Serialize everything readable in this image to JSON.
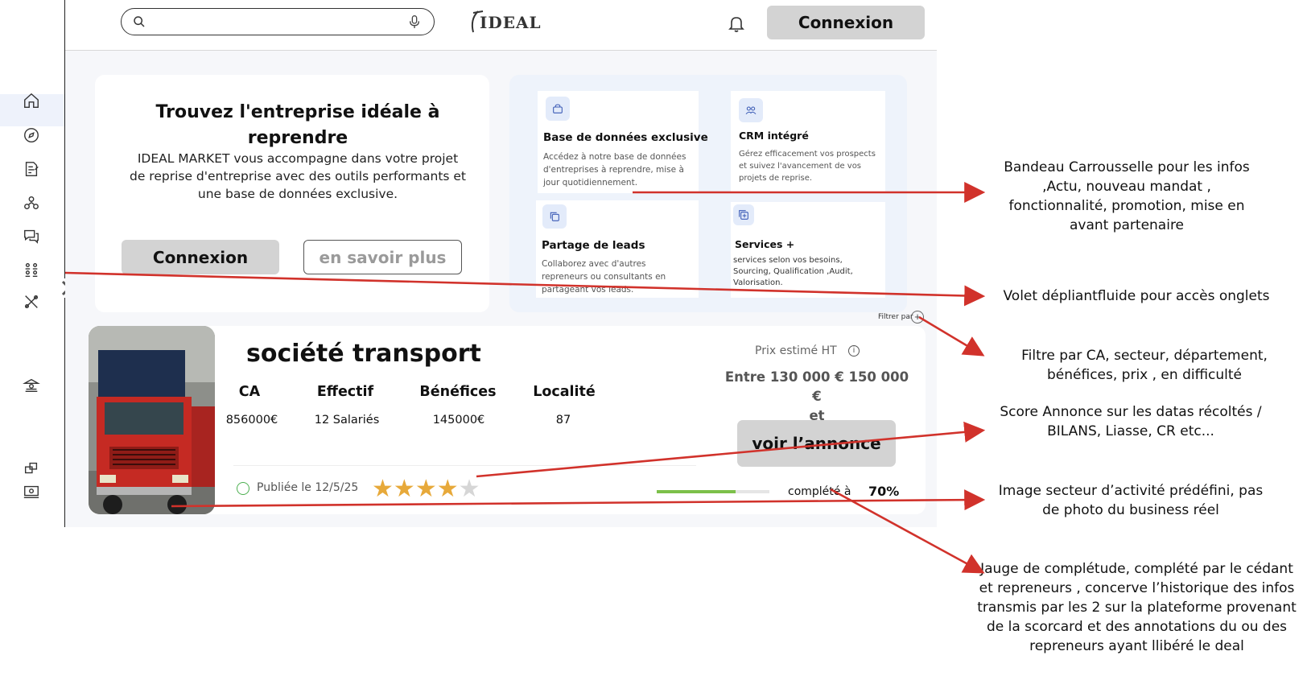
{
  "header": {
    "search_placeholder": "",
    "logo_text": "IDEAL",
    "connect_label": "Connexion"
  },
  "sidebar": {
    "items": [
      {
        "icon": "home-icon"
      },
      {
        "icon": "compass-icon"
      },
      {
        "icon": "document-edit-icon"
      },
      {
        "icon": "network-icon"
      },
      {
        "icon": "chat-icon"
      },
      {
        "icon": "team-icon"
      },
      {
        "icon": "tools-icon"
      },
      {
        "icon": "bank-icon"
      },
      {
        "icon": "shortcut-icon"
      },
      {
        "icon": "settings-screen-icon"
      }
    ]
  },
  "hero": {
    "title": "Trouvez l'entreprise idéale à reprendre",
    "subtitle": "IDEAL MARKET vous accompagne dans votre projet de reprise d'entreprise avec des outils performants et une base de données exclusive.",
    "connect_label": "Connexion",
    "learn_more_label": "en savoir plus"
  },
  "features": [
    {
      "title": "Base de données exclusive",
      "desc": "Accédez à notre base de données d'entreprises à reprendre, mise à jour quotidiennement.",
      "icon": "database-icon"
    },
    {
      "title": "CRM intégré",
      "desc": "Gérez efficacement vos prospects et suivez l'avancement de vos projets de reprise.",
      "icon": "users-icon"
    },
    {
      "title": "Partage de leads",
      "desc": "Collaborez avec d'autres repreneurs ou consultants en partageant vos leads.",
      "icon": "copy-icon"
    },
    {
      "title": "Services +",
      "desc": "services selon vos besoins, Sourcing, Qualification ,Audit, Valorisation.",
      "icon": "plus-square-icon"
    }
  ],
  "filter": {
    "label": "Filtrer par"
  },
  "listing": {
    "title": "société transport",
    "columns": [
      {
        "header": "CA",
        "value": "856000€"
      },
      {
        "header": "Effectif",
        "value": "12 Salariés"
      },
      {
        "header": "Bénéfices",
        "value": "145000€"
      },
      {
        "header": "Localité",
        "value": "87"
      }
    ],
    "price_label": "Prix estimé HT",
    "price_range_line1": "Entre 130 000  €  150 000 €",
    "price_range_line2": "et",
    "view_label": "voir l’annonce",
    "published": "Publiée le 12/5/25",
    "rating": 4,
    "rating_max": 5,
    "completion_label": "complété à",
    "completion_value": "70%",
    "completion_fraction": 0.7
  },
  "annotations": [
    {
      "text_lines": [
        "Bandeau Carrousselle pour les infos",
        ",Actu,  nouveau mandat ,",
        "fonctionnalité, promotion, mise en",
        "avant partenaire"
      ]
    },
    {
      "text_lines": [
        "Volet dépliantfluide pour accès onglets"
      ]
    },
    {
      "text_lines": [
        "Filtre par CA, secteur, département,",
        "bénéfices, prix , en difficulté"
      ]
    },
    {
      "text_lines": [
        "Score Annonce sur les datas récoltés /",
        "BILANS, Liasse, CR etc..."
      ]
    },
    {
      "text_lines": [
        "Image secteur d’activité prédéfini, pas",
        "de photo du business réel"
      ]
    },
    {
      "text_lines": [
        "Jauge de complétude, complété par le cédant",
        "et repreneurs , concerve l’historique des infos",
        "transmis par les 2 sur la plateforme provenant",
        "de la scorcard et des annotations du ou des",
        "repreneurs ayant llibéré le deal"
      ]
    }
  ],
  "colors": {
    "arrow": "#d1322b",
    "star": "#e7a93a",
    "gauge": "#7cc04a",
    "button_grey": "#d3d3d3"
  }
}
